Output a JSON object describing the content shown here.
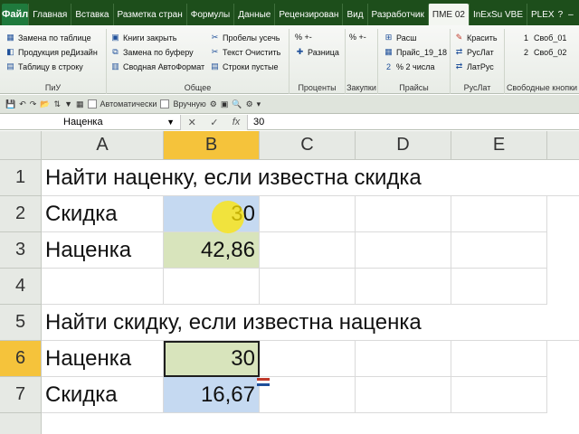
{
  "ribbon_tabs": {
    "file": "Файл",
    "tabs": [
      "Главная",
      "Вставка",
      "Разметка стран",
      "Формулы",
      "Данные",
      "Рецензирован",
      "Вид",
      "Разработчик",
      "ПМЕ 02",
      "InExSu VBE",
      "PLEX"
    ],
    "active_index": 8
  },
  "ribbon": {
    "group_piu": {
      "items": [
        "Замена по таблице",
        "Продукция реДизайн",
        "Таблицу в строку"
      ],
      "label": "ПиУ"
    },
    "group_obshee": {
      "items": [
        "Книги закрыть",
        "Замена по буферу",
        "Сводная АвтоФормат",
        "Пробелы усечь",
        "Текст Очистить",
        "Строки пустые"
      ],
      "label": "Общее"
    },
    "group_procenty": {
      "items": [
        "% +-",
        "Разница"
      ],
      "label": "Проценты"
    },
    "group_zakupki": {
      "items": [
        "% +-"
      ],
      "label": "Закупки"
    },
    "group_praisy": {
      "items": [
        "Расш",
        "Прайс_19_18",
        "% 2 числа"
      ],
      "label": "Прайсы"
    },
    "group_ruslat": {
      "items": [
        "Красить",
        "РусЛат",
        "ЛатРус"
      ],
      "label": "РусЛат"
    },
    "group_svob": {
      "items": [
        "Своб_01",
        "Своб_02"
      ],
      "label": "Свободные кнопки"
    }
  },
  "qat": {
    "auto_label": "Автоматически",
    "manual_label": "Вручную"
  },
  "formula_bar": {
    "name_box": "Наценка",
    "value": "30"
  },
  "grid": {
    "columns": [
      "A",
      "B",
      "C",
      "D",
      "E"
    ],
    "rows": [
      "1",
      "2",
      "3",
      "4",
      "5",
      "6",
      "7"
    ],
    "cells": {
      "A1": "Найти наценку, если известна скидка",
      "A2": "Скидка",
      "B2": "30",
      "A3": "Наценка",
      "B3": "42,86",
      "A5": "Найти скидку, если известна наценка",
      "A6": "Наценка",
      "B6": "30",
      "A7": "Скидка",
      "B7": "16,67"
    },
    "active_cell": "B6"
  }
}
